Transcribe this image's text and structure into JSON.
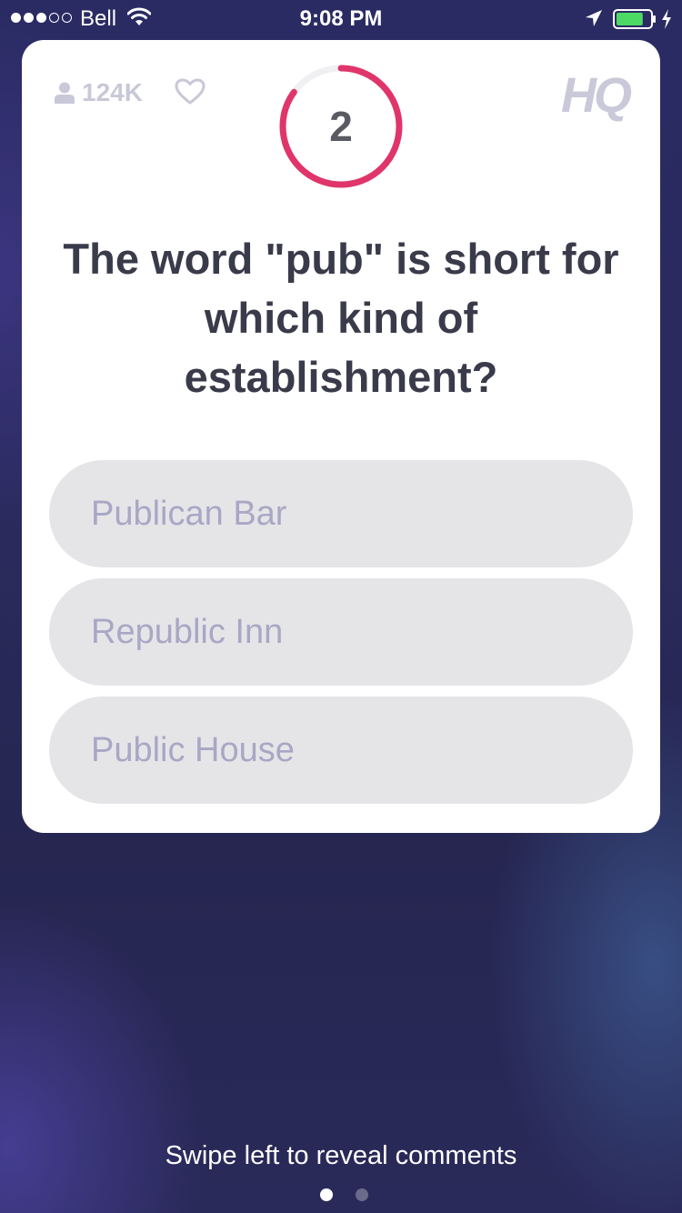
{
  "status_bar": {
    "signal_bars_filled": 3,
    "signal_bars_total": 5,
    "carrier": "Bell",
    "time": "9:08 PM",
    "battery_level": 0.8
  },
  "header": {
    "viewers_count": "124K",
    "timer_value": "2",
    "timer_fraction_remaining": 0.85,
    "logo": "HQ"
  },
  "question": {
    "text": "The word \"pub\" is short for which kind of establishment?"
  },
  "answers": [
    {
      "label": "Publican Bar"
    },
    {
      "label": "Republic Inn"
    },
    {
      "label": "Public House"
    }
  ],
  "footer": {
    "hint": "Swipe left to reveal comments",
    "page_count": 2,
    "active_page": 1
  },
  "colors": {
    "timer_ring": "#e0356b",
    "answer_background": "#e5e5e8",
    "answer_text": "#a9a7c5",
    "question_text": "#3a3b4a",
    "battery_fill": "#4cd964"
  }
}
